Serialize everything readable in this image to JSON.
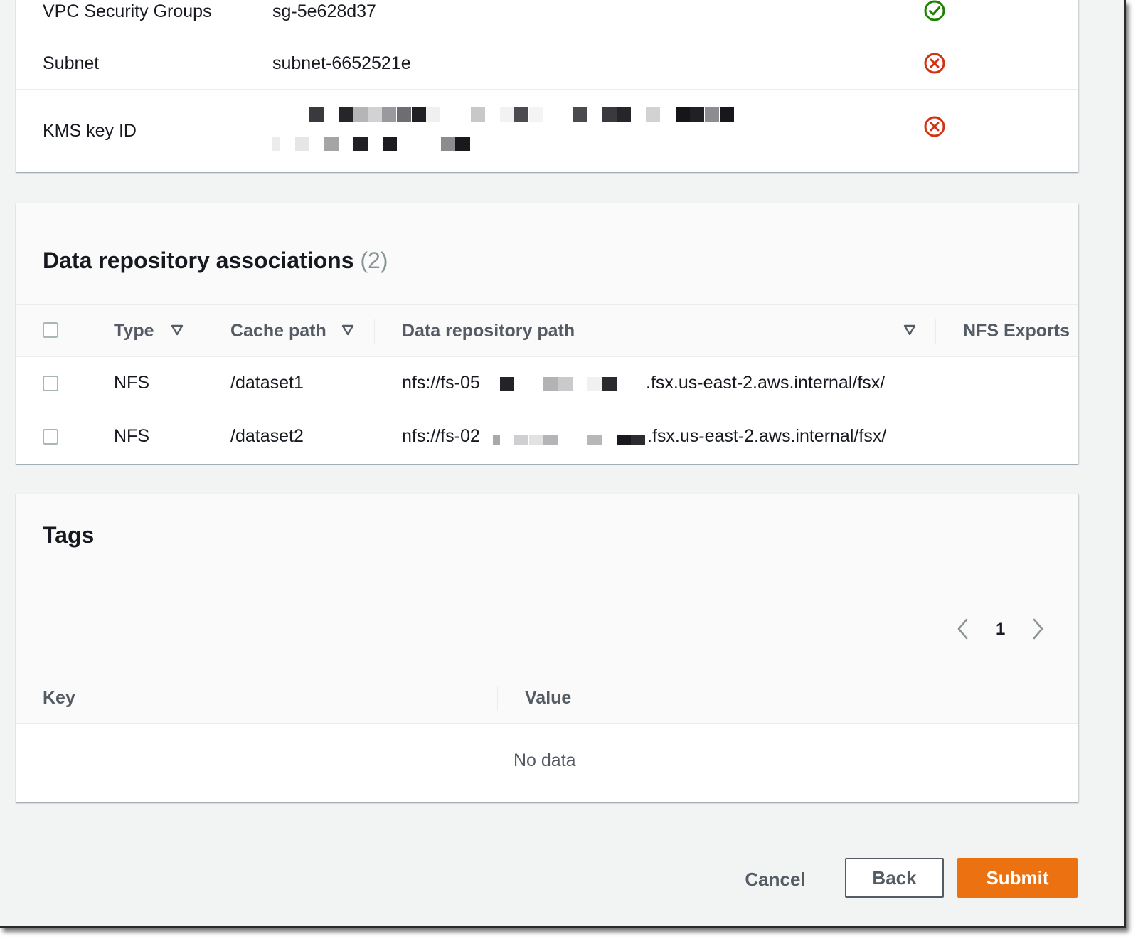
{
  "summary": {
    "rows": [
      {
        "label": "VPC Security Groups",
        "value": "sg-5e628d37",
        "status": "check-circle-icon",
        "status_color": "#1d8102"
      },
      {
        "label": "Subnet",
        "value": "subnet-6652521e",
        "status": "x-circle-icon",
        "status_color": "#d13212"
      },
      {
        "label": "KMS key ID",
        "value": "",
        "status": "x-circle-icon",
        "status_color": "#d13212"
      }
    ]
  },
  "dra": {
    "title": "Data repository associations",
    "count": "(2)",
    "columns": [
      "Type",
      "Cache path",
      "Data repository path",
      "NFS Exports"
    ],
    "rows": [
      {
        "type": "NFS",
        "cache_path": "/dataset1",
        "repo_path_prefix": "nfs://fs-05",
        "repo_path_suffix": ".fsx.us-east-2.aws.internal/fsx/"
      },
      {
        "type": "NFS",
        "cache_path": "/dataset2",
        "repo_path_prefix": "nfs://fs-02",
        "repo_path_suffix": ".fsx.us-east-2.aws.internal/fsx/"
      }
    ]
  },
  "tags": {
    "title": "Tags",
    "page": "1",
    "columns": [
      "Key",
      "Value"
    ],
    "empty": "No data"
  },
  "actions": {
    "cancel": "Cancel",
    "back": "Back",
    "submit": "Submit"
  },
  "colors": {
    "accent": "#ec7211",
    "success": "#1d8102",
    "error": "#d13212"
  }
}
